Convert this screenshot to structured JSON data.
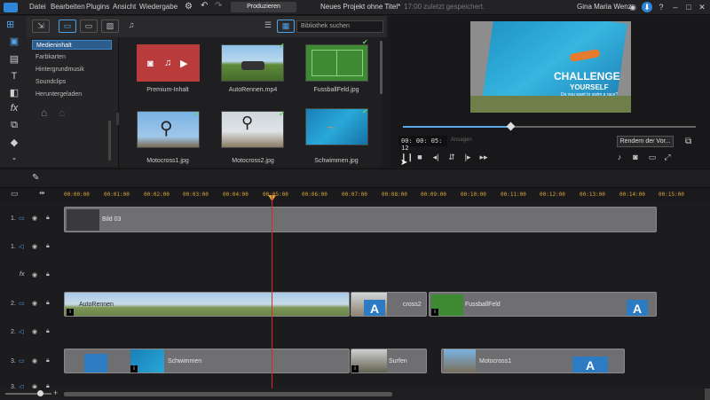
{
  "app": {
    "title": "Neues Projekt ohne Titel*",
    "save_status": "17:00 zuletzt gespeichert.",
    "user": "Gina Maria Wenz",
    "menu": [
      "Datei",
      "Bearbeiten",
      "Plugins",
      "Ansicht",
      "Wiedergabe"
    ],
    "produce_label": "Produzieren"
  },
  "library": {
    "search_placeholder": "Bibliothek suchen",
    "categories": [
      "Medieninhalt",
      "Farbkarten",
      "Hintergrundmusik",
      "Soundclips",
      "Heruntergeladen"
    ],
    "items": [
      {
        "label": "Premium-Inhalt"
      },
      {
        "label": "AutoRennen.mp4"
      },
      {
        "label": "FussballFeld.jpg"
      },
      {
        "label": "Motocross1.jpg"
      },
      {
        "label": "Motocross2.jpg"
      },
      {
        "label": "Schwimmen.jpg"
      }
    ]
  },
  "preview": {
    "headline": "CHALLENGE",
    "subheadline": "YOURSELF",
    "tagline": "Do you want to swim a race?",
    "timecode": "00: 00: 05: 12",
    "timecode_label": "Ansagen",
    "render_label": "Rendern der Vor...",
    "progress": 0.37
  },
  "timeline": {
    "ruler": [
      "00:00:00",
      "00:01:00",
      "00:02:00",
      "00:03:00",
      "00:04:00",
      "00:05:00",
      "00:06:00",
      "00:07:00",
      "00:08:00",
      "00:09:00",
      "00:10:00",
      "00:11:00",
      "00:12:00",
      "00:13:00",
      "00:14:00",
      "00:15:00"
    ],
    "tracks": [
      "1.",
      "1.",
      "fx",
      "2.",
      "2.",
      "3.",
      "3."
    ],
    "clips": {
      "t1": "Bild 03",
      "t2a": "AutoRennen",
      "t2b": "cross2",
      "t2c": "FussballFeld",
      "t3a": "Schwimmen",
      "t3b": "Surfen",
      "t3c": "Motocross1"
    },
    "clip_badge": "A"
  }
}
